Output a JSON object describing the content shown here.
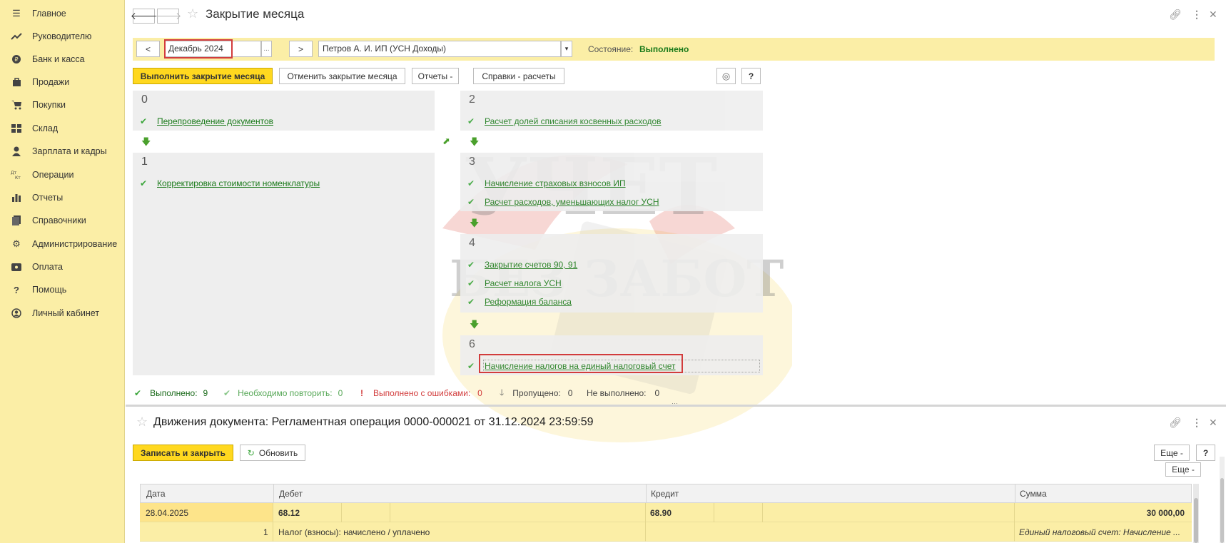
{
  "sidebar": {
    "items": [
      {
        "label": "Главное",
        "icon": "menu-icon"
      },
      {
        "label": "Руководителю",
        "icon": "trend-icon"
      },
      {
        "label": "Банк и касса",
        "icon": "bank-icon"
      },
      {
        "label": "Продажи",
        "icon": "bag-icon"
      },
      {
        "label": "Покупки",
        "icon": "cart-icon"
      },
      {
        "label": "Склад",
        "icon": "warehouse-icon"
      },
      {
        "label": "Зарплата и кадры",
        "icon": "person-icon"
      },
      {
        "label": "Операции",
        "icon": "dt-kt-icon"
      },
      {
        "label": "Отчеты",
        "icon": "bar-chart-icon"
      },
      {
        "label": "Справочники",
        "icon": "book-icon"
      },
      {
        "label": "Администрирование",
        "icon": "gear-icon"
      },
      {
        "label": "Оплата",
        "icon": "card-icon"
      },
      {
        "label": "Помощь",
        "icon": "question-icon"
      },
      {
        "label": "Личный кабинет",
        "icon": "account-icon"
      }
    ]
  },
  "header": {
    "title": "Закрытие месяца"
  },
  "period": {
    "prev": "<",
    "next": ">",
    "value": "Декабрь 2024",
    "dots": "...",
    "org": "Петров А. И. ИП (УСН Доходы)",
    "state_label": "Состояние:",
    "state_value": "Выполнено"
  },
  "actions": {
    "run": "Выполнить закрытие месяца",
    "cancel": "Отменить закрытие месяца",
    "reports": "Отчеты -",
    "refs": "Справки - расчеты",
    "help": "?"
  },
  "steps": {
    "s0": {
      "num": "0",
      "items": [
        "Перепроведение документов"
      ]
    },
    "s1": {
      "num": "1",
      "items": [
        "Корректировка стоимости номенклатуры"
      ]
    },
    "s2": {
      "num": "2",
      "items": [
        "Расчет долей списания косвенных расходов"
      ]
    },
    "s3": {
      "num": "3",
      "items": [
        "Начисление страховых взносов ИП",
        "Расчет расходов, уменьшающих налог УСН"
      ]
    },
    "s4": {
      "num": "4",
      "items": [
        "Закрытие счетов 90, 91",
        "Расчет налога УСН",
        "Реформация баланса"
      ]
    },
    "s6": {
      "num": "6",
      "items": [
        "Начисление налогов на единый налоговый счет"
      ]
    }
  },
  "status": {
    "done_label": "Выполнено:",
    "done": "9",
    "repeat_label": "Необходимо повторить:",
    "repeat": "0",
    "errors_label": "Выполнено с ошибками:",
    "errors": "0",
    "skipped_label": "Пропущено:",
    "skipped": "0",
    "notdone_label": "Не выполнено:",
    "notdone": "0"
  },
  "document": {
    "title": "Движения документа: Регламентная операция 0000-000021 от 31.12.2024 23:59:59",
    "save_close": "Записать и закрыть",
    "refresh": "Обновить",
    "more": "Еще -",
    "more2": "Еще -",
    "help": "?",
    "columns": [
      "Дата",
      "Дебет",
      "Кредит",
      "Сумма"
    ],
    "row": {
      "date": "28.04.2025",
      "debit": "68.12",
      "credit": "68.90",
      "amount": "30 000,00",
      "num": "1",
      "description": "Налог (взносы): начислено / уплачено",
      "content": "Единый налоговый счет: Начисление ..."
    }
  },
  "watermark": {
    "line1": "УЧЕТ",
    "line2": "БЕЗ ЗАБОТ"
  },
  "colors": {
    "sidebar_bg": "#fbeea6",
    "accent_yellow": "#ffd81f",
    "link_green": "#1a7a1a",
    "check_green": "#3aa53a",
    "highlight_red": "#d23c3c"
  }
}
